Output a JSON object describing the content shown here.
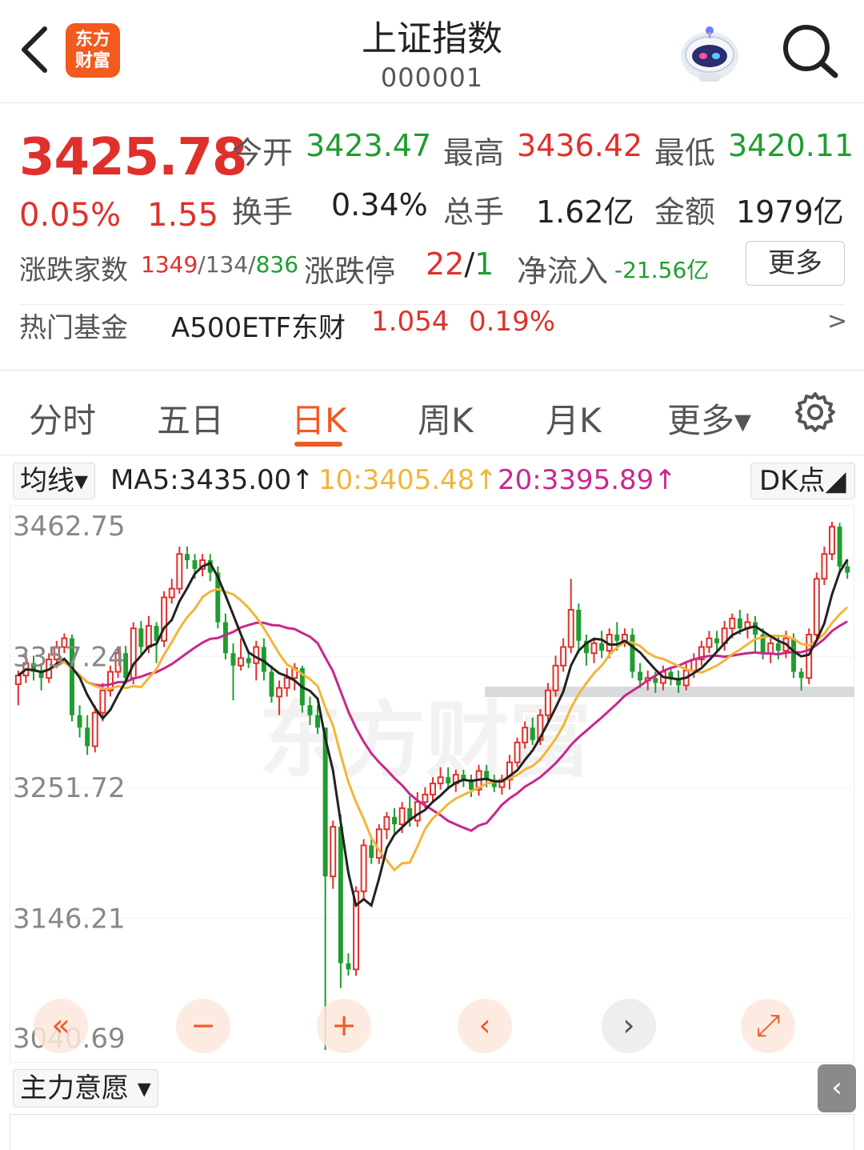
{
  "header": {
    "logo_line1": "东方",
    "logo_line2": "财富",
    "title": "上证指数",
    "code": "000001"
  },
  "quote": {
    "price": "3425.78",
    "change_pct": "0.05%",
    "change": "1.55",
    "open_label": "今开",
    "open": "3423.47",
    "high_label": "最高",
    "high": "3436.42",
    "low_label": "最低",
    "low": "3420.11",
    "turnover_label": "换手",
    "turnover": "0.34%",
    "volume_label": "总手",
    "volume": "1.62亿",
    "amount_label": "金额",
    "amount": "1979亿",
    "breadth_label": "涨跌家数",
    "breadth_up": "1349",
    "breadth_sep1": "/",
    "breadth_flat": "134",
    "breadth_sep2": "/",
    "breadth_down": "836",
    "limit_label": "涨跌停",
    "limit_up": "22",
    "limit_sep": "/",
    "limit_down": "1",
    "netflow_label": "净流入",
    "netflow": "-21.56亿",
    "more_label": "更多",
    "fund_label": "热门基金",
    "fund_name": "A500ETF东财",
    "fund_price": "1.054",
    "fund_pct": "0.19%",
    "fund_arrow": ">"
  },
  "tabs": [
    {
      "label": "分时"
    },
    {
      "label": "五日"
    },
    {
      "label": "日K",
      "active": true
    },
    {
      "label": "周K"
    },
    {
      "label": "月K"
    },
    {
      "label": "更多▾"
    }
  ],
  "ma_bar": {
    "selector": "均线▾",
    "ma5": "MA5:3435.00↑",
    "ma10": "10:3405.48↑",
    "ma20": "20:3395.89↑",
    "dk": "DK点◢"
  },
  "bottom": {
    "indicator_selector": "主力意愿 ▾",
    "side_tab": "‹"
  },
  "controls": [
    {
      "name": "fast-back",
      "symbol": "«"
    },
    {
      "name": "zoom-out",
      "symbol": "−"
    },
    {
      "name": "zoom-in",
      "symbol": "+"
    },
    {
      "name": "prev",
      "symbol": "‹"
    },
    {
      "name": "next",
      "symbol": "›"
    },
    {
      "name": "fullscreen",
      "symbol": "⤢"
    }
  ],
  "colors": {
    "up": "#e0302b",
    "down": "#1f9d2f",
    "accent": "#f15a24",
    "ma5": "#222222",
    "ma10": "#f2b53a",
    "ma20": "#c8288c"
  },
  "chart_data": {
    "type": "candlestick",
    "y_ticks": [
      "3462.75",
      "3357.24",
      "3251.72",
      "3146.21",
      "3040.69"
    ],
    "ylim": [
      3040.69,
      3462.75
    ],
    "watermark": "东方财富",
    "candles": [
      [
        3335,
        3342,
        3318,
        3346
      ],
      [
        3342,
        3352,
        3336,
        3360
      ],
      [
        3352,
        3345,
        3338,
        3358
      ],
      [
        3345,
        3340,
        3330,
        3352
      ],
      [
        3340,
        3355,
        3336,
        3360
      ],
      [
        3355,
        3365,
        3348,
        3370
      ],
      [
        3365,
        3372,
        3360,
        3376
      ],
      [
        3372,
        3310,
        3305,
        3375
      ],
      [
        3310,
        3300,
        3292,
        3318
      ],
      [
        3300,
        3285,
        3278,
        3310
      ],
      [
        3285,
        3312,
        3280,
        3318
      ],
      [
        3312,
        3330,
        3305,
        3336
      ],
      [
        3330,
        3345,
        3325,
        3350
      ],
      [
        3345,
        3360,
        3340,
        3365
      ],
      [
        3360,
        3340,
        3335,
        3366
      ],
      [
        3340,
        3380,
        3335,
        3385
      ],
      [
        3380,
        3365,
        3358,
        3386
      ],
      [
        3365,
        3382,
        3360,
        3390
      ],
      [
        3382,
        3370,
        3352,
        3385
      ],
      [
        3370,
        3405,
        3365,
        3410
      ],
      [
        3405,
        3412,
        3400,
        3420
      ],
      [
        3412,
        3440,
        3408,
        3446
      ],
      [
        3440,
        3435,
        3428,
        3446
      ],
      [
        3435,
        3428,
        3420,
        3440
      ],
      [
        3428,
        3435,
        3422,
        3440
      ],
      [
        3435,
        3425,
        3418,
        3440
      ],
      [
        3425,
        3385,
        3380,
        3430
      ],
      [
        3385,
        3360,
        3355,
        3392
      ],
      [
        3360,
        3350,
        3322,
        3368
      ],
      [
        3350,
        3356,
        3346,
        3372
      ],
      [
        3356,
        3352,
        3348,
        3362
      ],
      [
        3352,
        3365,
        3338,
        3370
      ],
      [
        3365,
        3345,
        3338,
        3372
      ],
      [
        3345,
        3325,
        3320,
        3350
      ],
      [
        3325,
        3332,
        3310,
        3338
      ],
      [
        3332,
        3340,
        3325,
        3348
      ],
      [
        3340,
        3348,
        3330,
        3352
      ],
      [
        3348,
        3318,
        3312,
        3350
      ],
      [
        3318,
        3310,
        3302,
        3325
      ],
      [
        3310,
        3300,
        3295,
        3318
      ],
      [
        3300,
        3180,
        3040,
        3185
      ],
      [
        3180,
        3220,
        3170,
        3225
      ],
      [
        3220,
        3110,
        3090,
        3230
      ],
      [
        3110,
        3105,
        3100,
        3118
      ],
      [
        3105,
        3168,
        3100,
        3172
      ],
      [
        3168,
        3205,
        3162,
        3210
      ],
      [
        3205,
        3195,
        3190,
        3210
      ],
      [
        3195,
        3218,
        3190,
        3222
      ],
      [
        3218,
        3228,
        3210,
        3232
      ],
      [
        3228,
        3222,
        3215,
        3235
      ],
      [
        3222,
        3235,
        3215,
        3240
      ],
      [
        3235,
        3225,
        3220,
        3245
      ],
      [
        3225,
        3240,
        3220,
        3248
      ],
      [
        3240,
        3246,
        3235,
        3252
      ],
      [
        3246,
        3255,
        3240,
        3260
      ],
      [
        3255,
        3260,
        3250,
        3268
      ],
      [
        3260,
        3255,
        3250,
        3268
      ],
      [
        3255,
        3262,
        3248,
        3266
      ],
      [
        3262,
        3258,
        3252,
        3266
      ],
      [
        3258,
        3250,
        3244,
        3262
      ],
      [
        3250,
        3265,
        3245,
        3270
      ],
      [
        3265,
        3258,
        3252,
        3270
      ],
      [
        3258,
        3252,
        3248,
        3262
      ],
      [
        3252,
        3258,
        3246,
        3262
      ],
      [
        3258,
        3272,
        3250,
        3278
      ],
      [
        3272,
        3288,
        3268,
        3292
      ],
      [
        3288,
        3300,
        3283,
        3305
      ],
      [
        3300,
        3290,
        3286,
        3308
      ],
      [
        3290,
        3310,
        3286,
        3315
      ],
      [
        3310,
        3330,
        3305,
        3336
      ],
      [
        3330,
        3350,
        3325,
        3358
      ],
      [
        3350,
        3365,
        3345,
        3372
      ],
      [
        3365,
        3395,
        3360,
        3420
      ],
      [
        3395,
        3370,
        3360,
        3400
      ],
      [
        3370,
        3360,
        3350,
        3375
      ],
      [
        3360,
        3368,
        3352,
        3372
      ],
      [
        3368,
        3362,
        3356,
        3378
      ],
      [
        3362,
        3375,
        3356,
        3380
      ],
      [
        3375,
        3370,
        3362,
        3385
      ],
      [
        3370,
        3375,
        3365,
        3380
      ],
      [
        3375,
        3345,
        3340,
        3380
      ],
      [
        3345,
        3338,
        3332,
        3352
      ],
      [
        3338,
        3340,
        3330,
        3346
      ],
      [
        3340,
        3336,
        3328,
        3345
      ],
      [
        3336,
        3345,
        3330,
        3350
      ],
      [
        3345,
        3340,
        3334,
        3348
      ],
      [
        3340,
        3334,
        3328,
        3346
      ],
      [
        3334,
        3346,
        3330,
        3352
      ],
      [
        3346,
        3355,
        3340,
        3360
      ],
      [
        3355,
        3365,
        3350,
        3370
      ],
      [
        3365,
        3372,
        3360,
        3378
      ],
      [
        3372,
        3368,
        3362,
        3378
      ],
      [
        3368,
        3380,
        3362,
        3386
      ],
      [
        3380,
        3388,
        3372,
        3392
      ],
      [
        3388,
        3380,
        3375,
        3395
      ],
      [
        3380,
        3385,
        3372,
        3392
      ],
      [
        3385,
        3375,
        3360,
        3390
      ],
      [
        3375,
        3360,
        3355,
        3380
      ],
      [
        3360,
        3368,
        3352,
        3372
      ],
      [
        3368,
        3362,
        3355,
        3375
      ],
      [
        3362,
        3372,
        3356,
        3378
      ],
      [
        3372,
        3345,
        3340,
        3376
      ],
      [
        3345,
        3340,
        3330,
        3348
      ],
      [
        3340,
        3375,
        3335,
        3380
      ],
      [
        3375,
        3420,
        3370,
        3425
      ],
      [
        3420,
        3440,
        3415,
        3446
      ],
      [
        3440,
        3462,
        3435,
        3466
      ],
      [
        3462,
        3430,
        3425,
        3465
      ],
      [
        3430,
        3425,
        3420,
        3436
      ]
    ]
  }
}
